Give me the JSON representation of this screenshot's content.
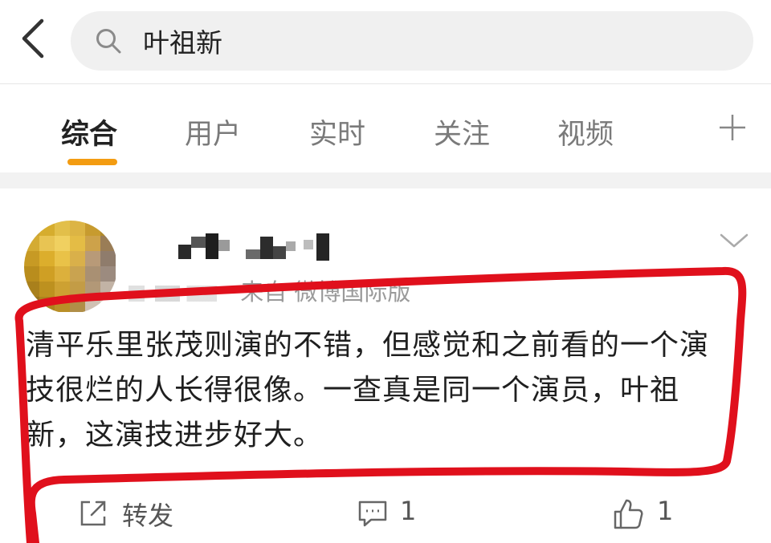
{
  "search": {
    "query": "叶祖新"
  },
  "tabs": [
    {
      "label": "综合",
      "active": true
    },
    {
      "label": "用户",
      "active": false
    },
    {
      "label": "实时",
      "active": false
    },
    {
      "label": "关注",
      "active": false
    },
    {
      "label": "视频",
      "active": false
    }
  ],
  "post": {
    "source": "来自 微博国际版",
    "text": "清平乐里张茂则演的不错，但感觉和之前看的一个演技很烂的人长得很像。一查真是同一个演员，叶祖新，这演技进步好大。",
    "actions": {
      "repost_label": "转发",
      "comment_count": "1",
      "like_count": "1"
    }
  },
  "colors": {
    "tab_indicator": "#f39c12",
    "highlight_red": "#e0101c",
    "search_bg": "#f0f0f0"
  },
  "icons": {
    "back": "chevron-left-icon",
    "search": "search-icon",
    "add_tab": "plus-icon",
    "more": "chevron-down-icon",
    "repost": "share-icon",
    "comment": "comment-icon",
    "like": "thumbs-up-icon"
  }
}
